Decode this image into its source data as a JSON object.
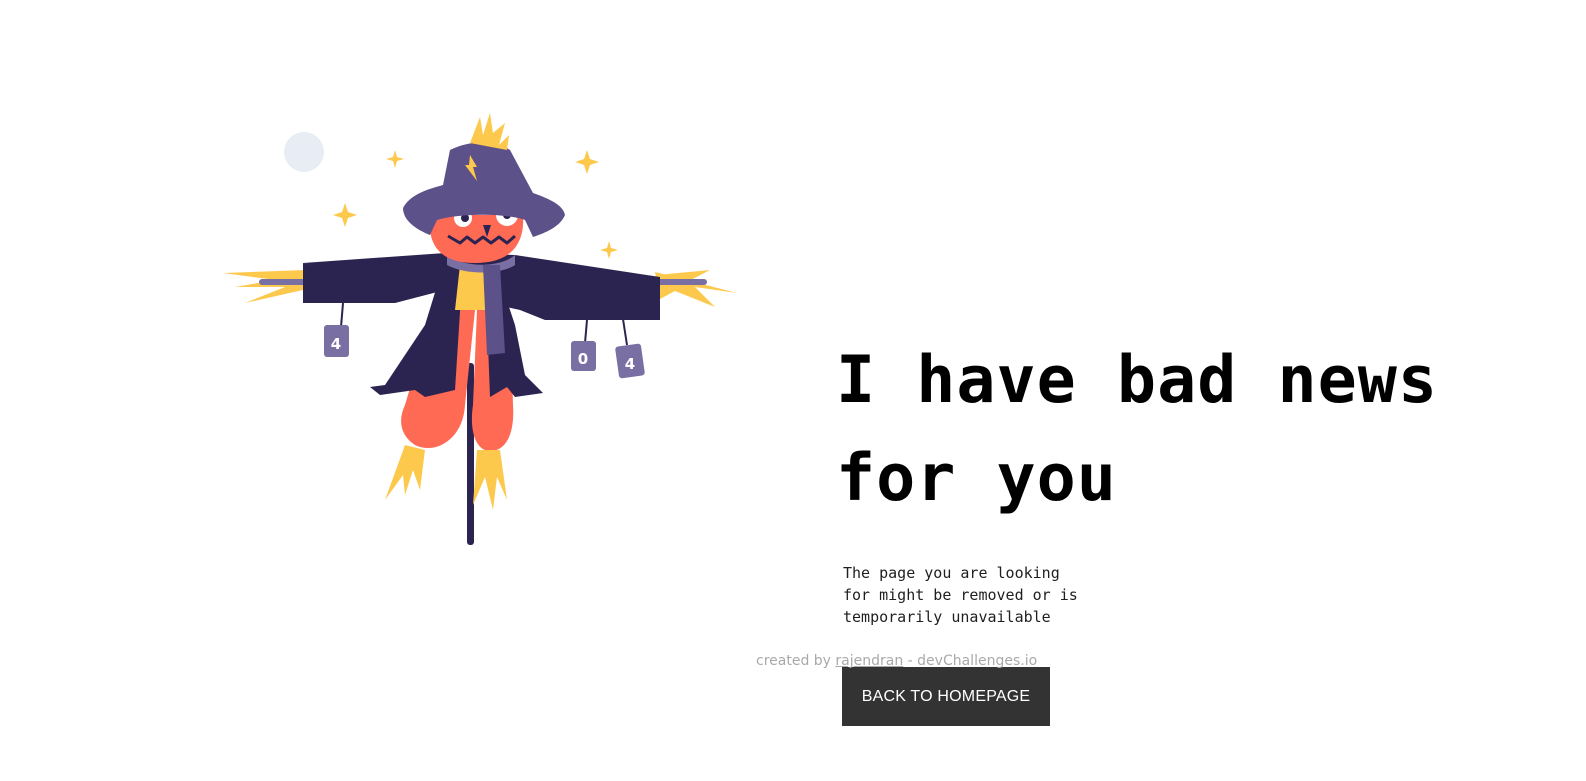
{
  "illustration": {
    "cans": [
      "4",
      "0",
      "4"
    ],
    "colors": {
      "hat": "#5c5189",
      "coat": "#2c2450",
      "face": "#ff6a55",
      "straw": "#fdc94d",
      "can": "#7a6fa3",
      "moon": "#e8ecf5"
    }
  },
  "main": {
    "headline_line1": "I have bad news",
    "headline_line2": "for you",
    "description_line1": "The page you are looking",
    "description_line2": "for might be removed or is",
    "description_line3": "temporarily unavailable",
    "back_button_label": "BACK TO HOMEPAGE"
  },
  "footer": {
    "prefix": "created by ",
    "author": "rajendran",
    "suffix": " - devChallenges.io"
  }
}
